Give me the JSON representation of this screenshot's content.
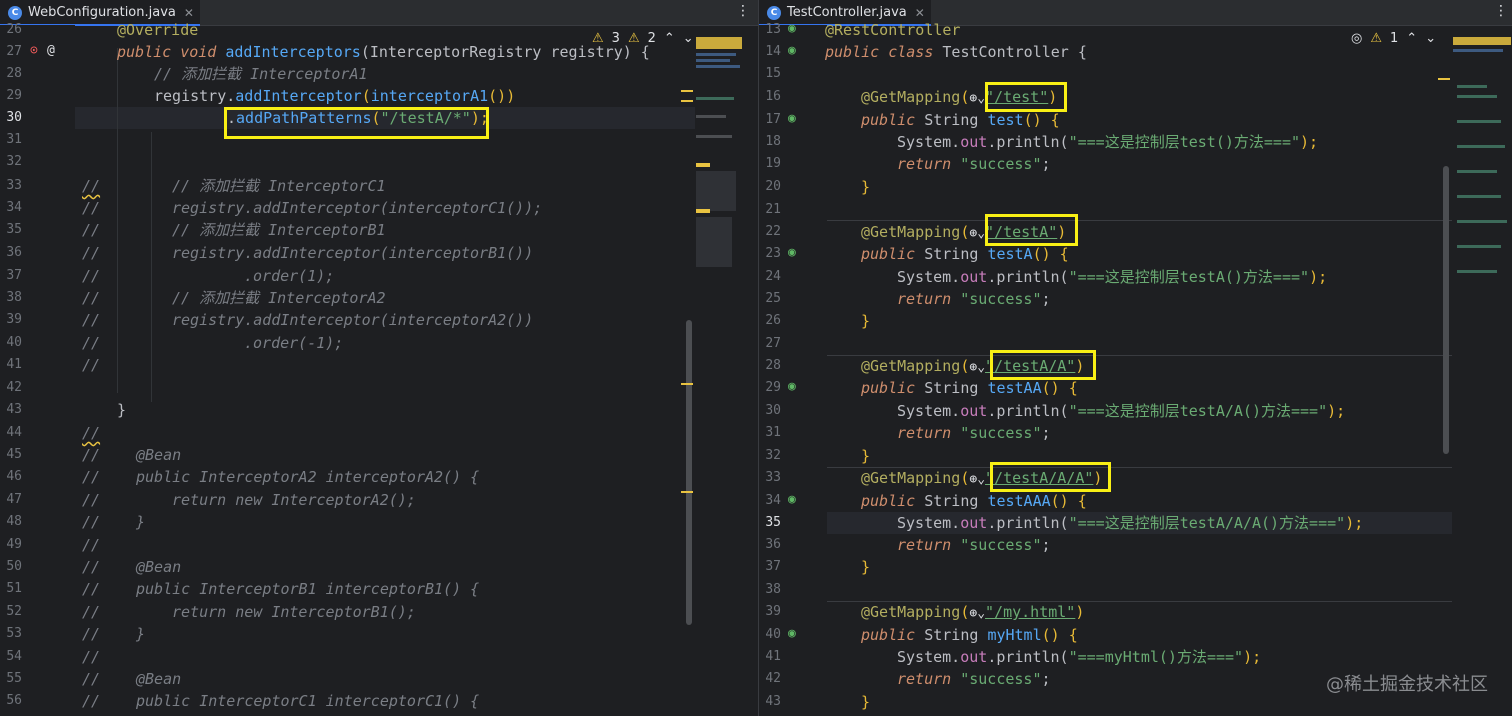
{
  "left_tab": {
    "icon": "java-class-icon",
    "name": "WebConfiguration.java",
    "close": "✕"
  },
  "right_tab": {
    "icon": "java-class-icon",
    "name": "TestController.java",
    "close": "✕"
  },
  "left_inspections": {
    "warnings": "3",
    "weak_warnings": "2"
  },
  "right_inspections": {
    "warnings": "1"
  },
  "left_lines": {
    "n26": "26",
    "n27": "27",
    "n28": "28",
    "n29": "29",
    "n30": "30",
    "n31": "31",
    "n32": "32",
    "n33": "33",
    "n34": "34",
    "n35": "35",
    "n36": "36",
    "n37": "37",
    "n38": "38",
    "n39": "39",
    "n40": "40",
    "n41": "41",
    "n42": "42",
    "n43": "43",
    "n44": "44",
    "n45": "45",
    "n46": "46",
    "n47": "47",
    "n48": "48",
    "n49": "49",
    "n50": "50",
    "n51": "51",
    "n52": "52",
    "n53": "53",
    "n54": "54",
    "n55": "55",
    "n56": "56"
  },
  "left_code": {
    "l26": "@Override",
    "l27_kw": "public void ",
    "l27_fn": "addInterceptors",
    "l27_rest": "(InterceptorRegistry registry) {",
    "l28": "// 添加拦截 InterceptorA1",
    "l29_a": "registry.",
    "l29_fn": "addInterceptor",
    "l29_b": "(",
    "l29_fn2": "interceptorA1",
    "l29_c": "())",
    "l30_a": ".",
    "l30_fn": "addPathPatterns",
    "l30_b": "(",
    "l30_str": "\"/testA/*\"",
    "l30_c": ");",
    "l33": "// 添加拦截 InterceptorC1",
    "l34": "registry.addInterceptor(interceptorC1());",
    "l35": "// 添加拦截 InterceptorB1",
    "l36": "registry.addInterceptor(interceptorB1())",
    "l37": ".order(1);",
    "l38": "// 添加拦截 InterceptorA2",
    "l39": "registry.addInterceptor(interceptorA2())",
    "l40": ".order(-1);",
    "l43": "}",
    "l45": "@Bean",
    "l46": "public InterceptorA2 interceptorA2() {",
    "l47": "return new InterceptorA2();",
    "l48": "}",
    "l50": "@Bean",
    "l51": "public InterceptorB1 interceptorB1() {",
    "l52": "return new InterceptorB1();",
    "l53": "}",
    "l55": "@Bean",
    "l56": "public InterceptorC1 interceptorC1() {",
    "comment_prefix": "//"
  },
  "right_lines": {
    "n13": "13",
    "n14": "14",
    "n15": "15",
    "n16": "16",
    "n17": "17",
    "n18": "18",
    "n19": "19",
    "n20": "20",
    "n21": "21",
    "n22": "22",
    "n23": "23",
    "n24": "24",
    "n25": "25",
    "n26": "26",
    "n27": "27",
    "n28": "28",
    "n29": "29",
    "n30": "30",
    "n31": "31",
    "n32": "32",
    "n33": "33",
    "n34": "34",
    "n35": "35",
    "n36": "36",
    "n37": "37",
    "n38": "38",
    "n39": "39",
    "n40": "40",
    "n41": "41",
    "n42": "42",
    "n43": "43"
  },
  "right_code": {
    "r13": "@RestController",
    "r14_kw": "public class ",
    "r14_cls": "TestController {",
    "getmapping": "@GetMapping",
    "public_string": "public ",
    "string_type": "String ",
    "sysout_a": "System.",
    "sysout_out": "out",
    "sysout_b": ".println(",
    "ret_kw": "return ",
    "ret_val": "\"success\"",
    "semi": ";",
    "brace_close": "}",
    "paren_close": ");",
    "open_body": "() {",
    "m1_path": "\"/test\"",
    "m1_fn": "test",
    "m1_msg": "\"===这是控制层test()方法===\"",
    "m2_path": "\"/testA\"",
    "m2_fn": "testA",
    "m2_msg": "\"===这是控制层testA()方法===\"",
    "m3_path": "\"/testA/A\"",
    "m3_fn": "testAA",
    "m3_msg": "\"===这是控制层testA/A()方法===\"",
    "m4_path": "\"/testA/A/A\"",
    "m4_fn": "testAAA",
    "m4_msg": "\"===这是控制层testA/A/A()方法===\"",
    "m5_path": "\"/my.html\"",
    "m5_fn": "myHtml",
    "m5_msg": "\"===myHtml()方法===\""
  },
  "watermark": "@稀土掘金技术社区",
  "colors": {
    "highlight": "#f8ef15",
    "keyword": "#cf8e6d",
    "string": "#6aab73",
    "function": "#56a8f5",
    "comment": "#7a7e85",
    "annotation": "#b3ae60"
  }
}
